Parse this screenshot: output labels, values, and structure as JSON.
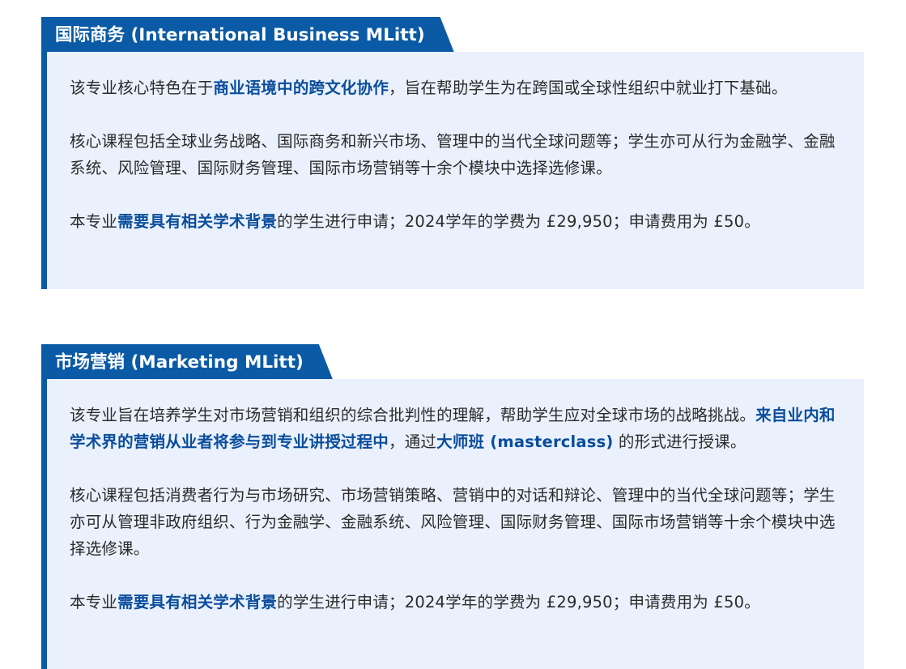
{
  "sections": [
    {
      "title": "国际商务 (International Business MLitt)",
      "p1": {
        "a": "该专业核心特色在于",
        "b": "商业语境中的跨文化协作",
        "c": "，旨在帮助学生为在跨国或全球性组织中就业打下基础。"
      },
      "p2": "核心课程包括全球业务战略、国际商务和新兴市场、管理中的当代全球问题等；学生亦可从行为金融学、金融系统、风险管理、国际财务管理、国际市场营销等十余个模块中选择选修课。",
      "p3": {
        "a": "本专业",
        "b": "需要具有相关学术背景",
        "c": "的学生进行申请；2024学年的学费为 £29,950；申请费用为 £50。"
      }
    },
    {
      "title": "市场营销 (Marketing MLitt)",
      "p1": {
        "a": "该专业旨在培养学生对市场营销和组织的综合批判性的理解，帮助学生应对全球市场的战略挑战。",
        "b": "来自业内和学术界的营销从业者将参与到专业讲授过程中",
        "c": "，通过",
        "d": "大师班 (masterclass)",
        "e": " 的形式进行授课。"
      },
      "p2": "核心课程包括消费者行为与市场研究、市场营销策略、营销中的对话和辩论、管理中的当代全球问题等；学生亦可从管理非政府组织、行为金融学、金融系统、风险管理、国际财务管理、国际市场营销等十余个模块中选择选修课。",
      "p3": {
        "a": "本专业",
        "b": "需要具有相关学术背景",
        "c": "的学生进行申请；2024学年的学费为 £29,950；申请费用为 £50。"
      }
    }
  ],
  "colors": {
    "accent": "#0a5aa5",
    "highlight_text": "#0a4d9c",
    "box_background": "#eaf1fd",
    "body_text": "#2b2b2b"
  }
}
